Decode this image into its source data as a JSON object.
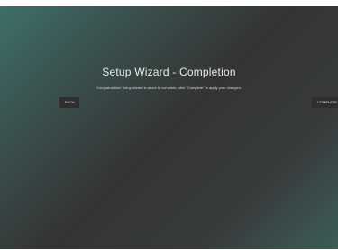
{
  "wizard": {
    "title": "Setup Wizard - Completion",
    "message": "Congratulation! Setup wizard is about to complete, click \"Complete\" to apply your changes.",
    "back_label": "BACK",
    "complete_label": "COMPLETE"
  },
  "colors": {
    "button_bg": "#2f2f2f",
    "text": "#e9e9e9"
  }
}
